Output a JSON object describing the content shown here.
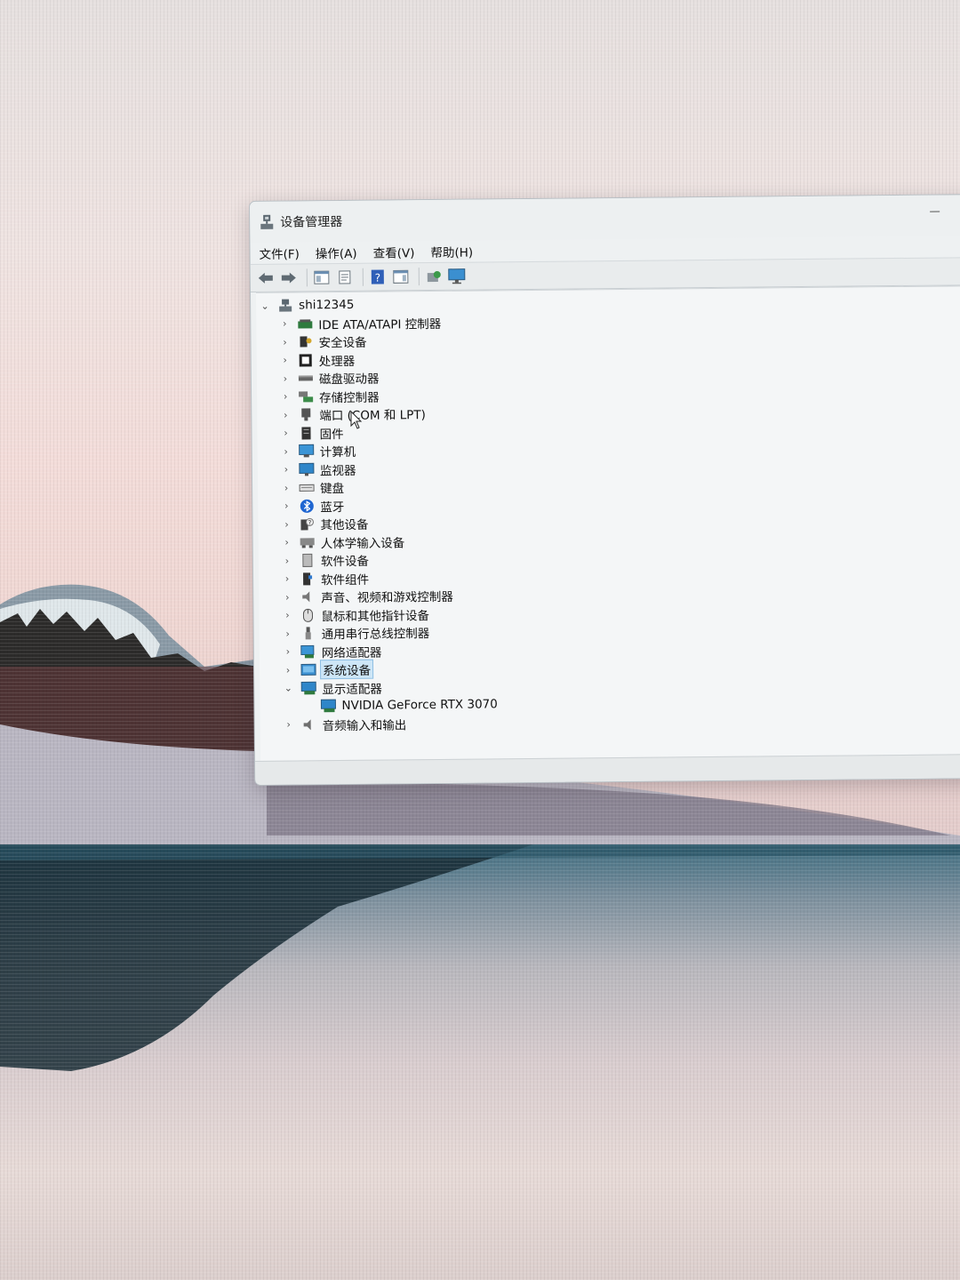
{
  "window": {
    "title": "设备管理器"
  },
  "menu": [
    "文件(F)",
    "操作(A)",
    "查看(V)",
    "帮助(H)"
  ],
  "toolbar": {
    "buttons": [
      {
        "icon": "back-arrow-icon"
      },
      {
        "icon": "forward-arrow-icon"
      },
      {
        "icon": "show-hide-console-tree-icon"
      },
      {
        "icon": "properties-icon"
      },
      {
        "icon": "help-icon"
      },
      {
        "icon": "action-pane-icon"
      },
      {
        "icon": "scan-hardware-changes-icon"
      },
      {
        "icon": "monitor-display-icon"
      }
    ]
  },
  "tree": {
    "root": "shi12345",
    "categories": [
      {
        "label": "IDE ATA/ATAPI 控制器",
        "icon": "ide-controller-icon",
        "expanded": false
      },
      {
        "label": "安全设备",
        "icon": "security-device-icon",
        "expanded": false
      },
      {
        "label": "处理器",
        "icon": "processor-icon",
        "expanded": false
      },
      {
        "label": "磁盘驱动器",
        "icon": "disk-drive-icon",
        "expanded": false
      },
      {
        "label": "存储控制器",
        "icon": "storage-controller-icon",
        "expanded": false
      },
      {
        "label": "端口 (COM 和 LPT)",
        "icon": "port-icon",
        "expanded": false
      },
      {
        "label": "固件",
        "icon": "firmware-icon",
        "expanded": false
      },
      {
        "label": "计算机",
        "icon": "computer-icon",
        "expanded": false
      },
      {
        "label": "监视器",
        "icon": "monitor-icon",
        "expanded": false
      },
      {
        "label": "键盘",
        "icon": "keyboard-icon",
        "expanded": false
      },
      {
        "label": "蓝牙",
        "icon": "bluetooth-icon",
        "expanded": false
      },
      {
        "label": "其他设备",
        "icon": "other-devices-icon",
        "expanded": false
      },
      {
        "label": "人体学输入设备",
        "icon": "hid-icon",
        "expanded": false
      },
      {
        "label": "软件设备",
        "icon": "software-device-icon",
        "expanded": false
      },
      {
        "label": "软件组件",
        "icon": "software-component-icon",
        "expanded": false
      },
      {
        "label": "声音、视频和游戏控制器",
        "icon": "sound-icon",
        "expanded": false
      },
      {
        "label": "鼠标和其他指针设备",
        "icon": "mouse-icon",
        "expanded": false
      },
      {
        "label": "通用串行总线控制器",
        "icon": "usb-icon",
        "expanded": false
      },
      {
        "label": "网络适配器",
        "icon": "network-adapter-icon",
        "expanded": false
      },
      {
        "label": "系统设备",
        "icon": "system-devices-icon",
        "expanded": false,
        "selected": true
      },
      {
        "label": "显示适配器",
        "icon": "display-adapter-icon",
        "expanded": true,
        "children": [
          {
            "label": "NVIDIA GeForce RTX 3070",
            "icon": "display-adapter-icon"
          }
        ]
      },
      {
        "label": "音频输入和输出",
        "icon": "audio-io-icon",
        "expanded": false
      }
    ]
  },
  "colors": {
    "selection_bg": "#cde6f7",
    "selection_border": "#8fbfe3",
    "window_bg": "#eef1f2"
  }
}
